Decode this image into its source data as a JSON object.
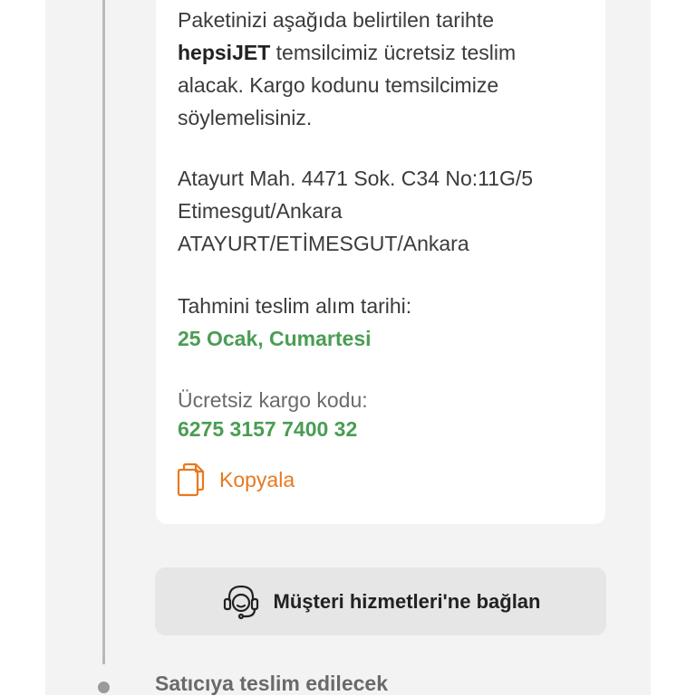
{
  "card": {
    "desc_part1": "Paketinizi aşağıda belirtilen tarihte ",
    "carrier": "hepsiJET",
    "desc_part2": " temsilcimiz ücretsiz teslim alacak. Kargo kodunu temsilcimize söylemelisiniz.",
    "address_lines": [
      "Atayurt Mah. 4471 Sok. C34 No:11G/5",
      "Etimesgut/Ankara",
      "ATAYURT/ETİMESGUT/Ankara"
    ],
    "estimated_label": "Tahmini teslim alım tarihi:",
    "estimated_value": "25 Ocak, Cumartesi",
    "code_label": "Ücretsiz kargo kodu:",
    "code_value": "6275 3157 7400 32",
    "copy_label": "Kopyala",
    "copy_icon": "copy-icon"
  },
  "support": {
    "label": "Müşteri hizmetleri'ne bağlan",
    "icon": "headset-icon"
  },
  "timeline": {
    "next_step_label": "Satıcıya teslim edilecek"
  },
  "colors": {
    "accent_green": "#4a9d54",
    "accent_orange": "#e8791f",
    "background": "#f3f3f3"
  }
}
